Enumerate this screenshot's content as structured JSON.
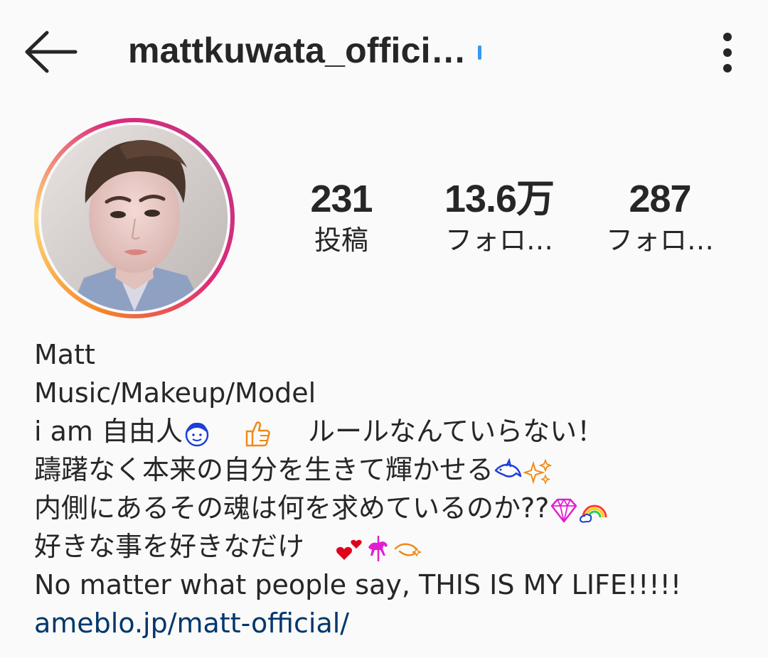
{
  "header": {
    "username": "mattkuwata_offici…",
    "back_icon": "arrow-left-icon",
    "more_icon": "more-vertical-icon"
  },
  "profile": {
    "avatar_icon": "profile-photo"
  },
  "stats": {
    "posts": {
      "value": "231",
      "label": "投稿"
    },
    "followers": {
      "value": "13.6万",
      "label": "フォロ…"
    },
    "following": {
      "value": "287",
      "label": "フォロ…"
    }
  },
  "bio": {
    "name": "Matt",
    "category": "Music/Makeup/Model",
    "line1_a": "i am 自由人",
    "line1_b": "ルールなんていらない！",
    "line2": "躊躇なく本来の自分を生きて輝かせる",
    "line3": "内側にあるその魂は何を求めているのか??",
    "line4": "好きな事を好きなだけ",
    "line5": "No matter what people say, THIS IS MY LIFE!!!!!",
    "link": "ameblo.jp/matt-official/"
  },
  "colors": {
    "background": "#fafafa",
    "text": "#262626",
    "link": "#00376b",
    "verified": "#3897f0"
  }
}
